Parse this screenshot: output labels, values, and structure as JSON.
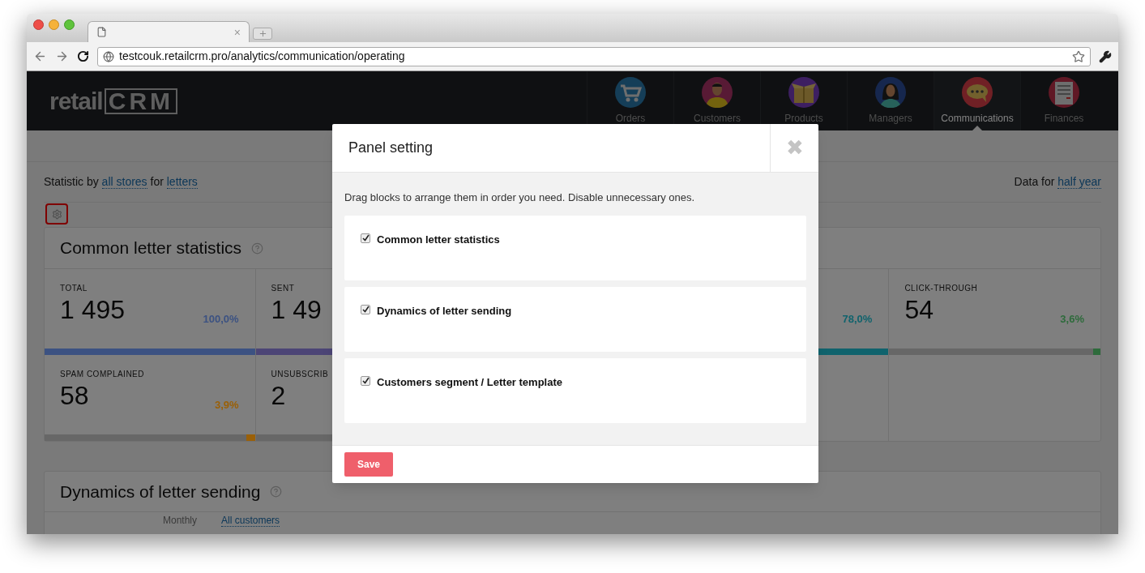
{
  "browser": {
    "tab": {
      "close": "×"
    },
    "url": "testcouk.retailcrm.pro/analytics/communication/operating"
  },
  "header": {
    "logo": {
      "word": "retail",
      "mark": "CRM"
    },
    "nav": [
      {
        "label": "Orders",
        "selected": false
      },
      {
        "label": "Customers",
        "selected": false
      },
      {
        "label": "Products",
        "selected": false
      },
      {
        "label": "Managers",
        "selected": false
      },
      {
        "label": "Communications",
        "selected": true
      },
      {
        "label": "Finances",
        "selected": false
      }
    ]
  },
  "filter": {
    "prefix": "Statistic by",
    "stores": "all stores",
    "middle": "for",
    "type": "letters",
    "period_prefix": "Data for",
    "period": "half year"
  },
  "stats_panel": {
    "title": "Common letter statistics",
    "rows": [
      [
        {
          "kind": "stat",
          "label": "TOTAL",
          "value": "1 495",
          "percent": "100,0%",
          "color": "#3c5282",
          "level": 1
        },
        {
          "kind": "stat",
          "label": "SENT",
          "value": "1 49",
          "color": "#4c4576",
          "level": 1
        },
        {
          "kind": "blank"
        },
        {
          "kind": "stat",
          "percent": "78,0%",
          "color": "#10636d",
          "level": 1
        },
        {
          "kind": "stat",
          "label": "CLICK-THROUGH",
          "value": "54",
          "percent": "3,6%",
          "color": "#2e6b3c",
          "level": 0.036
        }
      ],
      [
        {
          "kind": "stat",
          "label": "SPAM COMPLAINED",
          "value": "58",
          "percent": "3,9%",
          "color": "#9a6008",
          "level": 0.039
        },
        {
          "kind": "stat",
          "label": "UNSUBSCRIB",
          "value": "2"
        },
        {
          "kind": "blank"
        },
        {
          "kind": "blank"
        },
        {
          "kind": "blank"
        }
      ]
    ]
  },
  "dynamics_panel": {
    "title": "Dynamics of letter sending",
    "period": "Monthly",
    "segment": "All customers"
  },
  "modal": {
    "title": "Panel setting",
    "close": "✖",
    "hint": "Drag blocks to arrange them in order you need. Disable unnecessary ones.",
    "blocks": [
      {
        "label": "Common letter statistics",
        "checked": true
      },
      {
        "label": "Dynamics of letter sending",
        "checked": true
      },
      {
        "label": "Customers segment / Letter template",
        "checked": true
      }
    ],
    "save": "Save"
  }
}
